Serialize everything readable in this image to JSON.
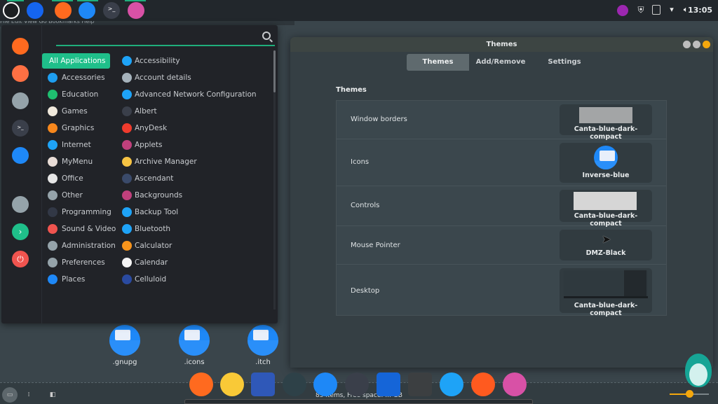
{
  "top_panel": {
    "menubar_items": [
      "File",
      "Edit",
      "View",
      "Go",
      "Bookmarks",
      "Help"
    ],
    "launchers": [
      {
        "name": "linux-mint-menu-icon",
        "color": "#1c1f22"
      },
      {
        "name": "blue-app-icon",
        "color": "#1565f0"
      },
      {
        "name": "firefox-icon",
        "color": "#ff6a1f"
      },
      {
        "name": "files-icon",
        "color": "#1e88f7"
      },
      {
        "name": "terminal-icon",
        "color": "#3a3f4a"
      },
      {
        "name": "theme-app-icon",
        "color": "#d851a6"
      }
    ],
    "tray": [
      "firefox-lightning-icon",
      "shield-icon",
      "drive-icon",
      "wifi-icon",
      "volume-icon"
    ],
    "clock": "13:05"
  },
  "menu": {
    "search_placeholder": "",
    "search_value": "",
    "favorites": [
      {
        "name": "firefox-icon",
        "color": "#ff6a1f"
      },
      {
        "name": "shop-icon",
        "color": "#ff7043"
      },
      {
        "name": "settings-icon",
        "color": "#95a3aa"
      },
      {
        "name": "terminal-icon",
        "color": "#3a3f4a"
      },
      {
        "name": "files-icon",
        "color": "#1e88f7"
      },
      {
        "name": "lock-icon",
        "color": "#95a3aa"
      },
      {
        "name": "logout-icon",
        "color": "#1fbf8a"
      },
      {
        "name": "power-icon",
        "color": "#f0544f"
      }
    ],
    "categories": [
      {
        "label": "All Applications",
        "selected": true,
        "color": ""
      },
      {
        "label": "Accessories",
        "color": "#1e9ef0"
      },
      {
        "label": "Education",
        "color": "#1fbf70"
      },
      {
        "label": "Games",
        "color": "#f0e9dc"
      },
      {
        "label": "Graphics",
        "color": "#f7871c"
      },
      {
        "label": "Internet",
        "color": "#1ea3f7"
      },
      {
        "label": "MyMenu",
        "color": "#e8dcd6"
      },
      {
        "label": "Office",
        "color": "#e6e6e6"
      },
      {
        "label": "Other",
        "color": "#95a3aa"
      },
      {
        "label": "Programming",
        "color": "#323846"
      },
      {
        "label": "Sound & Video",
        "color": "#f0544f"
      },
      {
        "label": "Administration",
        "color": "#95a3aa"
      },
      {
        "label": "Preferences",
        "color": "#95a3aa"
      },
      {
        "label": "Places",
        "color": "#1e88f7"
      }
    ],
    "applications": [
      {
        "label": "Accessibility",
        "color": "#1ea3f7"
      },
      {
        "label": "Account details",
        "color": "#a6b3bc"
      },
      {
        "label": "Advanced Network Configuration",
        "color": "#1ea3f7"
      },
      {
        "label": "Albert",
        "color": "#3a3f4a"
      },
      {
        "label": "AnyDesk",
        "color": "#ef3b2d"
      },
      {
        "label": "Applets",
        "color": "#c0407c"
      },
      {
        "label": "Archive Manager",
        "color": "#f6c343"
      },
      {
        "label": "Ascendant",
        "color": "#3a4a6a"
      },
      {
        "label": "Backgrounds",
        "color": "#c0407c"
      },
      {
        "label": "Backup Tool",
        "color": "#1ea3f7"
      },
      {
        "label": "Bluetooth",
        "color": "#1ea3f7"
      },
      {
        "label": "Calculator",
        "color": "#f7941c"
      },
      {
        "label": "Calendar",
        "color": "#f5f5f5"
      },
      {
        "label": "Celluloid",
        "color": "#2a4aa0"
      }
    ]
  },
  "themes_window": {
    "title": "Themes",
    "tabs": [
      "Themes",
      "Add/Remove",
      "Settings"
    ],
    "active_tab": "Themes",
    "section_title": "Themes",
    "rows": [
      {
        "label": "Window borders",
        "value": "Canta-blue-dark-compact"
      },
      {
        "label": "Icons",
        "value": "Inverse-blue"
      },
      {
        "label": "Controls",
        "value": "Canta-blue-dark-compact"
      },
      {
        "label": "Mouse Pointer",
        "value": "DMZ-Black"
      },
      {
        "label": "Desktop",
        "value": "Canta-blue-dark-compact"
      }
    ]
  },
  "desktop_files": [
    ".gnupg",
    ".icons",
    ".itch"
  ],
  "dock": {
    "apps": [
      {
        "name": "firefox-icon",
        "color": "#ff6a1f"
      },
      {
        "name": "notes-icon",
        "color": "#f9c937"
      },
      {
        "name": "video-editor-icon",
        "color": "#2f58b8"
      },
      {
        "name": "stacer-icon",
        "color": "#2e4148"
      },
      {
        "name": "files-icon",
        "color": "#1e88f7"
      },
      {
        "name": "terminal-icon",
        "color": "#3a3f4a"
      },
      {
        "name": "joplin-icon",
        "color": "#1565d8"
      },
      {
        "name": "sublime-icon",
        "color": "#3c3f41"
      },
      {
        "name": "cpu-x-icon",
        "color": "#1ea3f7"
      },
      {
        "name": "recorder-icon",
        "color": "#ff5a1f"
      },
      {
        "name": "theme-app-icon",
        "color": "#d851a6"
      }
    ],
    "status_text": "85 items, Free space: ... GB",
    "zoom_level": 0.5
  }
}
